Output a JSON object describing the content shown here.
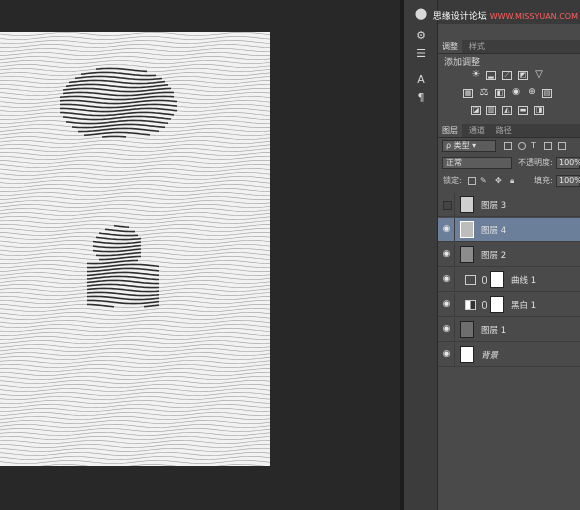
{
  "watermark": {
    "cn": "思缘设计论坛",
    "en": "WWW.MISSYUAN.COM"
  },
  "adjustments_panel": {
    "tabs": [
      {
        "label": "调整"
      },
      {
        "label": "样式"
      }
    ],
    "title": "添加调整",
    "row1_icons": [
      "brightness-icon",
      "levels-icon",
      "curves-icon",
      "exposure-icon",
      "vibrance-icon"
    ],
    "row2_icons": [
      "hue-saturation-icon",
      "color-balance-icon",
      "black-white-icon",
      "photo-filter-icon",
      "channel-mixer-icon",
      "color-lookup-icon"
    ],
    "row3_icons": [
      "invert-icon",
      "posterize-icon",
      "threshold-icon",
      "gradient-map-icon",
      "selective-color-icon"
    ]
  },
  "layers_panel": {
    "tabs": [
      {
        "label": "图层"
      },
      {
        "label": "通道"
      },
      {
        "label": "路径"
      }
    ],
    "filter_kind": "类型",
    "blend_mode": "正常",
    "opacity_label": "不透明度:",
    "opacity_value": "100%",
    "lock_label": "锁定:",
    "fill_label": "填充:",
    "fill_value": "100%",
    "layers": [
      {
        "name": "图层 3",
        "visible": false,
        "selected": false,
        "kind": "pixel"
      },
      {
        "name": "图层 4",
        "visible": true,
        "selected": true,
        "kind": "pixel"
      },
      {
        "name": "图层 2",
        "visible": true,
        "selected": false,
        "kind": "pixel"
      },
      {
        "name": "曲线 1",
        "visible": true,
        "selected": false,
        "kind": "adjustment"
      },
      {
        "name": "黑白 1",
        "visible": true,
        "selected": false,
        "kind": "adjustment"
      },
      {
        "name": "图层 1",
        "visible": true,
        "selected": false,
        "kind": "pixel"
      },
      {
        "name": "背景",
        "visible": true,
        "selected": false,
        "kind": "background"
      }
    ]
  },
  "colors": {
    "selection": "#6b7f9b",
    "panel_bg": "#4a4a4a",
    "canvas_bg": "#282828"
  }
}
